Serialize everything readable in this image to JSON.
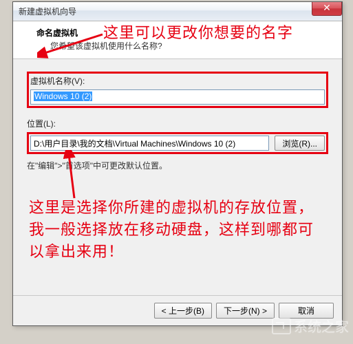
{
  "window": {
    "title": "新建虚拟机向导",
    "close_glyph": "✕"
  },
  "header": {
    "title": "命名虚拟机",
    "subtitle": "您希望该虚拟机使用什么名称?"
  },
  "fields": {
    "name_label": "虚拟机名称(V):",
    "name_value": "Windows 10 (2)",
    "location_label": "位置(L):",
    "location_value": "D:\\用户目录\\我的文档\\Virtual Machines\\Windows 10 (2)",
    "browse_label": "浏览(R)..."
  },
  "hint": "在\"编辑\">\"首选项\"中可更改默认位置。",
  "footer": {
    "back": "< 上一步(B)",
    "next": "下一步(N) >",
    "cancel": "取消"
  },
  "annotations": {
    "top": "这里可以更改你想要的名字",
    "bottom": "这里是选择你所建的虚拟机的存放位置，我一般选择放在移动硬盘，这样到哪都可以拿出来用！"
  },
  "watermark": "系统之家"
}
